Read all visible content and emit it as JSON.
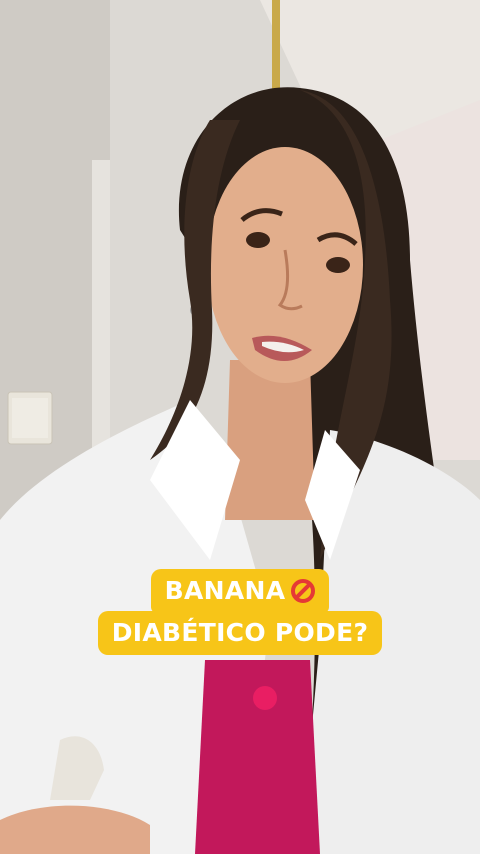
{
  "caption": {
    "line1": "BANANA",
    "line1_icon": "prohibited-icon",
    "line2": "DIABÉTICO PODE?"
  },
  "colors": {
    "caption_bg": "#f7c518",
    "caption_text": "#ffffff",
    "prohibited": "#e53935"
  }
}
